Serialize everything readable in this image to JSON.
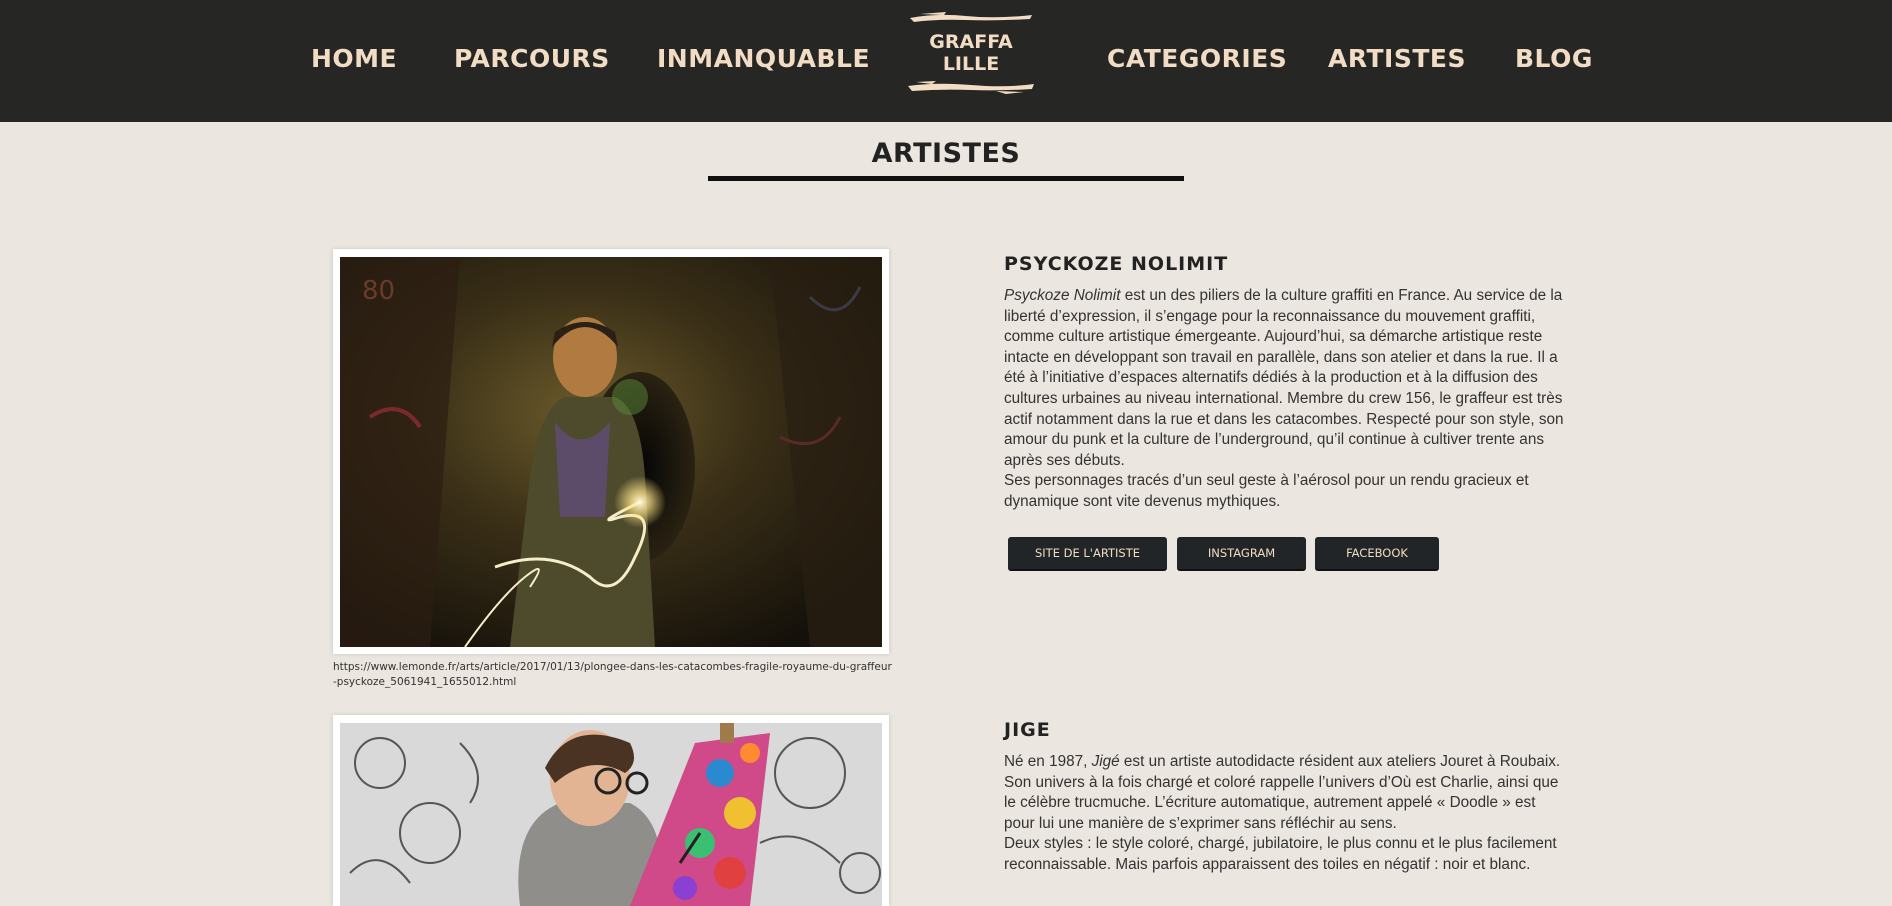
{
  "nav": {
    "home": "HOME",
    "parcours": "PARCOURS",
    "inmanquable": "INMANQUABLE",
    "categories": "CATEGORIES",
    "artistes": "ARTISTES",
    "blog": "BLOG"
  },
  "logo": {
    "line1": "GRAFFA",
    "line2": "LILLE"
  },
  "page_title": "ARTISTES",
  "artists": [
    {
      "name": "PSYCKOZE NOLIMIT",
      "italic_lead": "Psyckoze Nolimit",
      "para1_rest": " est un des piliers de la culture graffiti en France. Au service de la liberté d’expression, il s’engage pour la reconnaissance du mouvement graffiti, comme culture artistique émergeante. Aujourd’hui, sa démarche artistique reste intacte en développant son travail en parallèle, dans son atelier et dans la rue. Il a été à l’initiative d’espaces alternatifs dédiés à la production et à la diffusion des cultures urbaines au niveau international. Membre du crew 156, le graffeur est très actif notamment dans la rue et dans les catacombes. Respecté pour son style, son amour du punk et la culture de l’underground, qu’il continue à cultiver trente ans après ses débuts.",
      "para2": "Ses personnages tracés d’un seul geste à l’aérosol pour un rendu gracieux et dynamique sont vite devenus mythiques.",
      "buttons": {
        "site": "SITE DE L'ARTISTE",
        "instagram": "INSTAGRAM",
        "facebook": "FACEBOOK"
      },
      "caption": "https://www.lemonde.fr/arts/article/2017/01/13/plongee-dans-les-catacombes-fragile-royaume-du-graffeur-psyckoze_5061941_1655012.html"
    },
    {
      "name": "JIGE",
      "para1_start": "Né en 1987, ",
      "italic_mid": "Jigé",
      "para1_rest": " est un artiste autodidacte résident aux ateliers Jouret à Roubaix. Son univers à la fois chargé et coloré rappelle l’univers d’Où est Charlie, ainsi que le célèbre trucmuche. L’écriture automatique, autrement appelé « Doodle » est pour lui une manière de s’exprimer sans réfléchir au sens.",
      "para2": "Deux styles : le style coloré, chargé, jubilatoire, le plus connu et le plus facilement reconnaissable. Mais parfois apparaissent des toiles en négatif : noir et blanc."
    }
  ],
  "colors": {
    "nav_bg": "#262725",
    "nav_text": "#f2ddc4",
    "page_bg": "#ebe6df",
    "button_bg": "#222528"
  }
}
